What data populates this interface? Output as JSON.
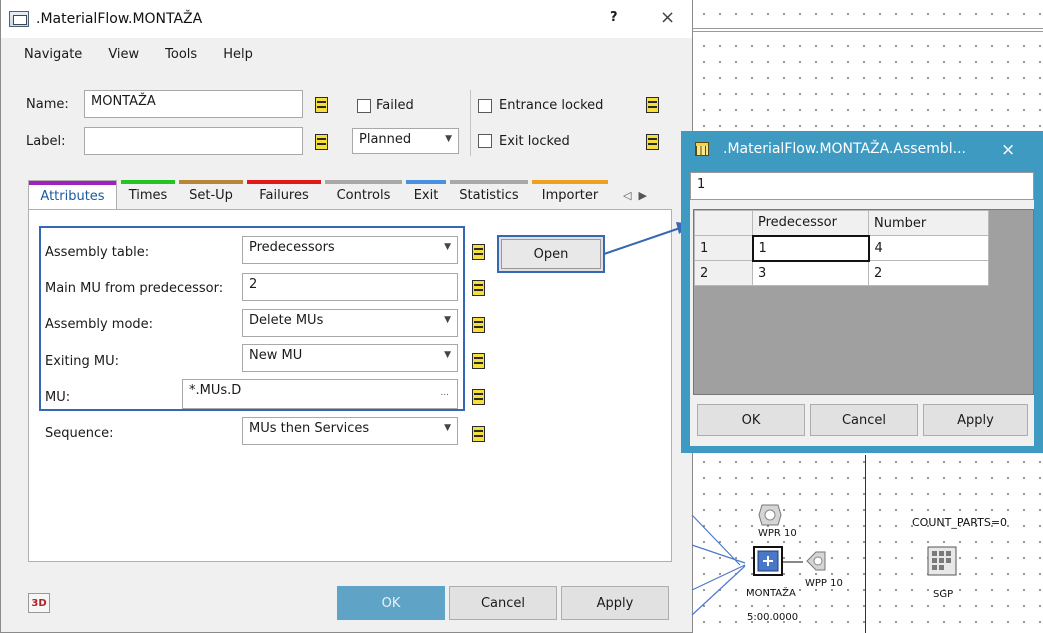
{
  "dialog": {
    "title": ".MaterialFlow.MONTAŽA",
    "help": "?",
    "close": "×"
  },
  "menu": [
    "Navigate",
    "View",
    "Tools",
    "Help"
  ],
  "header": {
    "name_label": "Name:",
    "name_value": "MONTAŽA",
    "label_label": "Label:",
    "label_value": "",
    "failed_label": "Failed",
    "status_value": "Planned",
    "entrance_locked_label": "Entrance locked",
    "exit_locked_label": "Exit locked"
  },
  "tabs": [
    {
      "label": "Attributes",
      "color": "#a020c0"
    },
    {
      "label": "Times",
      "color": "#22c422"
    },
    {
      "label": "Set-Up",
      "color": "#b8863a"
    },
    {
      "label": "Failures",
      "color": "#e01818"
    },
    {
      "label": "Controls",
      "color": "#a8a8a8"
    },
    {
      "label": "Exit",
      "color": "#4a90e0"
    },
    {
      "label": "Statistics",
      "color": "#a8a8a8"
    },
    {
      "label": "Importer",
      "color": "#f0a020"
    }
  ],
  "attributes": {
    "assembly_table_label": "Assembly table:",
    "assembly_table_value": "Predecessors",
    "main_mu_label": "Main MU from predecessor:",
    "main_mu_value": "2",
    "assembly_mode_label": "Assembly mode:",
    "assembly_mode_value": "Delete MUs",
    "exiting_mu_label": "Exiting MU:",
    "exiting_mu_value": "New MU",
    "mu_label": "MU:",
    "mu_value": "*.MUs.D",
    "mu_browse": "...",
    "sequence_label": "Sequence:",
    "sequence_value": "MUs then Services",
    "open_label": "Open"
  },
  "footer": {
    "btn3d": "3D",
    "ok": "OK",
    "cancel": "Cancel",
    "apply": "Apply"
  },
  "table_dialog": {
    "title": ".MaterialFlow.MONTAŽA.Assembl...",
    "close": "×",
    "input_value": "1",
    "columns": [
      "Predecessor",
      "Number"
    ],
    "rows": [
      {
        "index": "1",
        "predecessor": "1",
        "number": "4"
      },
      {
        "index": "2",
        "predecessor": "3",
        "number": "2"
      }
    ],
    "ok": "OK",
    "cancel": "Cancel",
    "apply": "Apply"
  },
  "canvas": {
    "count_parts": "COUNT_PARTS=0",
    "wpr": "WPR 10",
    "wpp": "WPP 10",
    "station": "MONTAŽA",
    "time": "5:00.0000",
    "sgp": "SGP"
  }
}
